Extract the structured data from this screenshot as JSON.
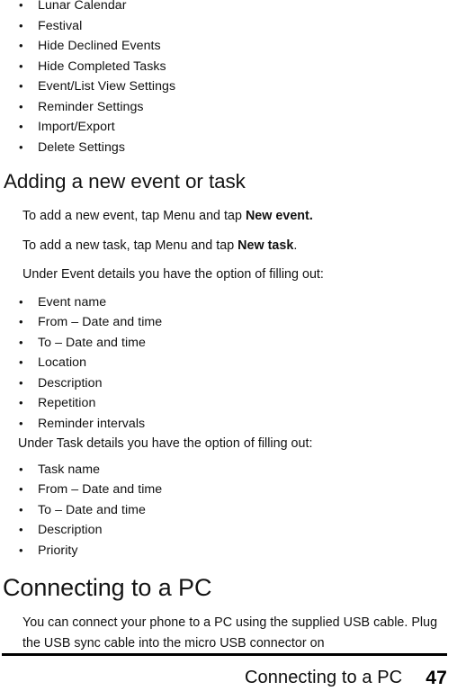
{
  "page": {
    "number": "47",
    "footer_title": "Connecting to a PC"
  },
  "calendar_settings_list": {
    "items": [
      "Lunar Calendar",
      "Festival",
      "Hide Declined Events",
      "Hide Completed Tasks",
      "Event/List View Settings",
      "Reminder Settings",
      "Import/Export",
      "Delete Settings"
    ],
    "bullet_glyph": "•"
  },
  "section_adding": {
    "heading": "Adding a new event or task",
    "para_event_prefix": "To add a new event, tap Menu and tap ",
    "para_event_bold": "New event.",
    "para_task_prefix": "To add a new task, tap Menu and tap ",
    "para_task_bold": "New task",
    "para_task_suffix": ".",
    "event_lead_in": "Under Event details you have the option of filling out:",
    "event_details": [
      "Event name",
      "From – Date and time",
      "To – Date and time",
      "Location",
      "Description",
      "Repetition",
      "Reminder intervals"
    ],
    "task_lead_in": "Under Task details you have the option of filling out:",
    "task_details": [
      "Task name",
      "From – Date and time",
      "To – Date and time",
      "Description",
      "Priority"
    ]
  },
  "section_connecting": {
    "heading": "Connecting to a PC",
    "paragraph": "You can connect your phone to a PC using the supplied USB cable. Plug the USB sync cable into the micro USB connector on"
  }
}
